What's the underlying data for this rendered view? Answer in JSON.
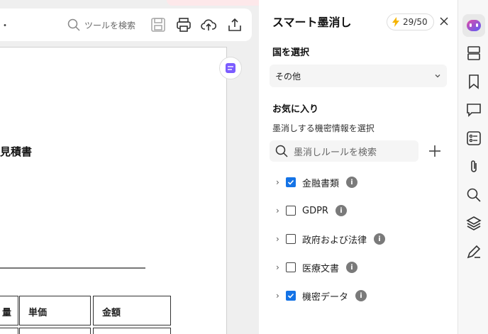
{
  "toolbar": {
    "menu_dot": "・",
    "search_label": "ツールを検索"
  },
  "document": {
    "title_fragment": "見積書",
    "table_headers": [
      "量",
      "単価",
      "金額"
    ]
  },
  "panel": {
    "title": "スマート墨消し",
    "credits": "29/50",
    "country_label": "国を選択",
    "country_value": "その他",
    "favorites_label": "お気に入り",
    "favorites_sub": "墨消しする機密情報を選択",
    "search_placeholder": "墨消しルールを検索",
    "rules": [
      {
        "label": "金融書類",
        "checked": true
      },
      {
        "label": "GDPR",
        "checked": false
      },
      {
        "label": "政府および法律",
        "checked": false
      },
      {
        "label": "医療文書",
        "checked": false
      },
      {
        "label": "機密データ",
        "checked": true
      }
    ]
  },
  "colors": {
    "accent": "#1473e6",
    "ai_accent": "#7b5cff"
  }
}
